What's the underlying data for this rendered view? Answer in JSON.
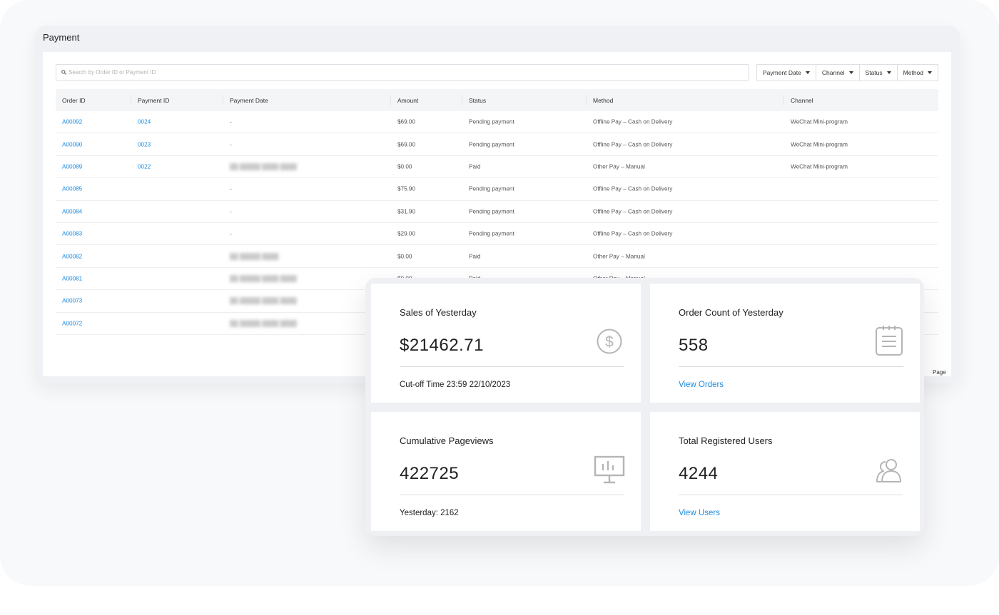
{
  "window": {
    "title": "Payment"
  },
  "search": {
    "placeholder": "Search by Order ID or Payment ID"
  },
  "filters": [
    "Payment Date",
    "Channel",
    "Status",
    "Method"
  ],
  "table": {
    "columns": [
      "Order ID",
      "Payment ID",
      "Payment Date",
      "Amount",
      "Status",
      "Method",
      "Channel"
    ],
    "rows": [
      {
        "order_id": "A00092",
        "payment_id": "0024",
        "payment_date": "-",
        "amount": "$69.00",
        "status": "Pending payment",
        "method": "Offline Pay – Cash on Delivery",
        "channel": "WeChat Mini-program"
      },
      {
        "order_id": "A00090",
        "payment_id": "0023",
        "payment_date": "-",
        "amount": "$69.00",
        "status": "Pending payment",
        "method": "Offline Pay – Cash on Delivery",
        "channel": "WeChat Mini-program"
      },
      {
        "order_id": "A00089",
        "payment_id": "0022",
        "payment_date": "██ █████ ████ ████",
        "amount": "$0.00",
        "status": "Paid",
        "method": "Other Pay – Manual",
        "channel": "WeChat Mini-program"
      },
      {
        "order_id": "A00085",
        "payment_id": "",
        "payment_date": "-",
        "amount": "$75.90",
        "status": "Pending payment",
        "method": "Offline Pay – Cash on Delivery",
        "channel": ""
      },
      {
        "order_id": "A00084",
        "payment_id": "",
        "payment_date": "-",
        "amount": "$31.90",
        "status": "Pending payment",
        "method": "Offline Pay – Cash on Delivery",
        "channel": ""
      },
      {
        "order_id": "A00083",
        "payment_id": "",
        "payment_date": "-",
        "amount": "$29.00",
        "status": "Pending payment",
        "method": "Offline Pay – Cash on Delivery",
        "channel": ""
      },
      {
        "order_id": "A00082",
        "payment_id": "",
        "payment_date": "██ █████ ████",
        "amount": "$0.00",
        "status": "Paid",
        "method": "Other Pay – Manual",
        "channel": ""
      },
      {
        "order_id": "A00081",
        "payment_id": "",
        "payment_date": "██ █████ ████ ████",
        "amount": "$0.00",
        "status": "Paid",
        "method": "Other Pay – Manual",
        "channel": ""
      },
      {
        "order_id": "A00073",
        "payment_id": "",
        "payment_date": "██ █████ ████ ████",
        "amount": "",
        "status": "",
        "method": "",
        "channel": ""
      },
      {
        "order_id": "A00072",
        "payment_id": "",
        "payment_date": "██ █████ ████ ████",
        "amount": "",
        "status": "",
        "method": "",
        "channel": ""
      }
    ]
  },
  "pagination": {
    "tail_label": "Page"
  },
  "dashboard": {
    "cards": [
      {
        "label": "Sales of Yesterday",
        "value": "$21462.71",
        "footer": "Cut-off Time 23:59 22/10/2023",
        "footer_is_link": false,
        "icon": "dollar-circle-icon"
      },
      {
        "label": "Order Count of Yesterday",
        "value": "558",
        "footer": "View Orders",
        "footer_is_link": true,
        "icon": "clipboard-icon"
      },
      {
        "label": "Cumulative Pageviews",
        "value": "422725",
        "footer": "Yesterday:  2162",
        "footer_is_link": false,
        "icon": "presentation-chart-icon"
      },
      {
        "label": "Total Registered Users",
        "value": "4244",
        "footer": "View Users",
        "footer_is_link": true,
        "icon": "users-icon"
      }
    ]
  },
  "colors": {
    "link": "#1d8ce0",
    "icon": "#b5b5b5",
    "backdrop": "#f8f9fa",
    "window": "#eff1f4",
    "header_row": "#f4f5f7"
  }
}
